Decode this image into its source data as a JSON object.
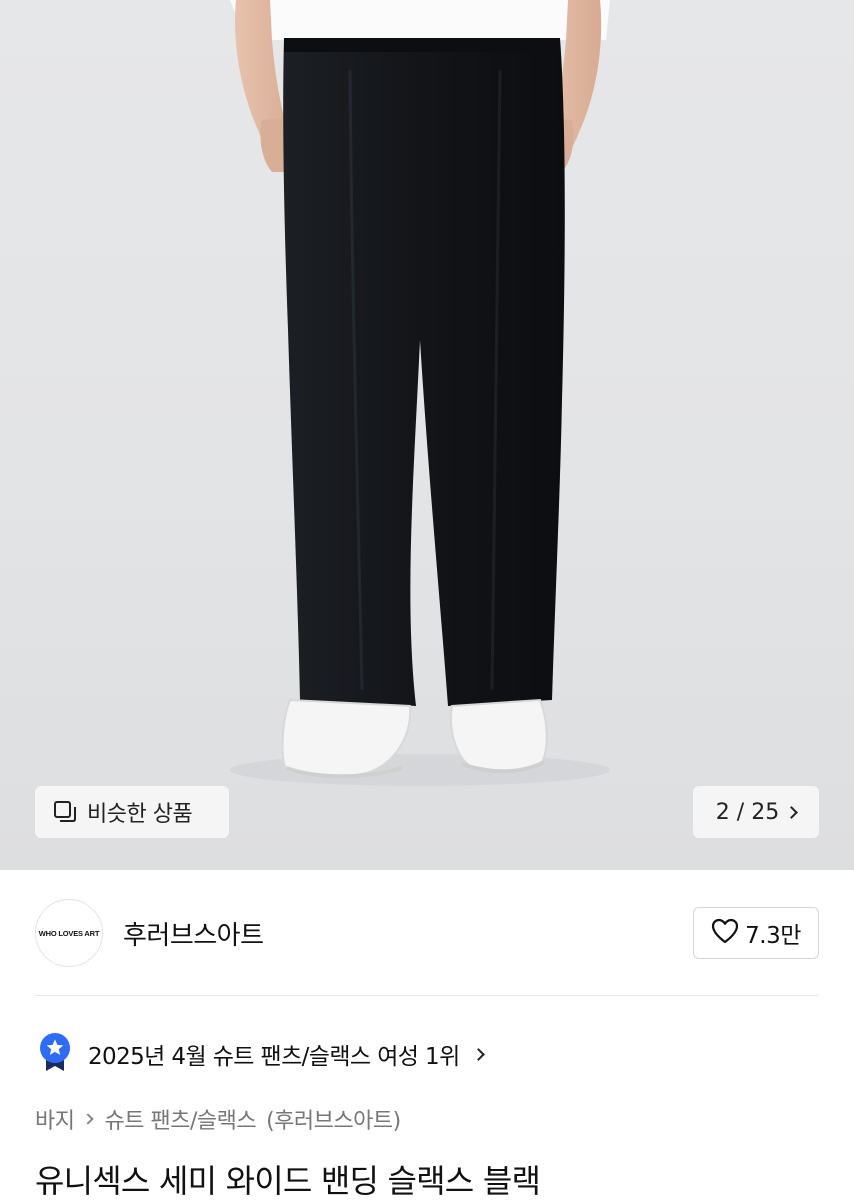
{
  "gallery": {
    "similar_label": "비슷한 상품",
    "similar_icon": "stacked-squares-icon",
    "counter": "2 / 25",
    "next_icon": "chevron-right-icon"
  },
  "brand": {
    "logo_text": "WHO LOVES ART",
    "name": "후러브스아트",
    "like_icon": "heart-outline-icon",
    "like_count": "7.3만"
  },
  "ranking": {
    "icon": "blue-star-badge-icon",
    "text": "2025년 4월 슈트 팬츠/슬랙스 여성 1위"
  },
  "breadcrumb": {
    "items": [
      "바지",
      "슈트 팬츠/슬랙스"
    ],
    "brand": "(후러브스아트)"
  },
  "product": {
    "title": "유니섹스 세미 와이드 밴딩 슬랙스 블랙"
  },
  "colors": {
    "badge_blue": "#2f6cf6",
    "pants": "#15171b",
    "background": "#e4e5e7"
  }
}
